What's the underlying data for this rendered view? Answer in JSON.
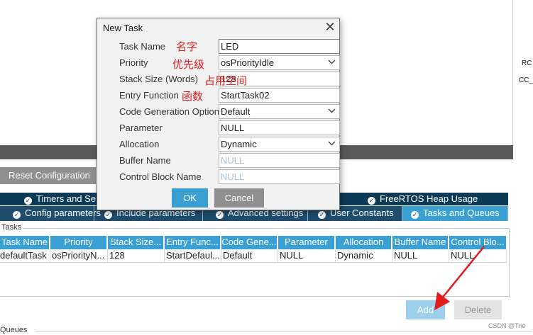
{
  "background": {
    "right_labels": [
      "RC",
      "CC_"
    ],
    "reset_button": "Reset Configuration",
    "tabs_row1": [
      {
        "label": "Timers and Se"
      },
      {
        "label": "FreeRTOS Heap Usage"
      }
    ],
    "tabs_row2": [
      {
        "label": "Config parameters"
      },
      {
        "label": "Include parameters"
      },
      {
        "label": "Advanced settings"
      },
      {
        "label": "User Constants"
      },
      {
        "label": "Tasks and Queues"
      }
    ],
    "tasks_group_label": "Tasks",
    "table": {
      "columns": [
        "Task Name",
        "Priority",
        "Stack Size...",
        "Entry Func...",
        "Code Gene...",
        "Parameter",
        "Allocation",
        "Buffer Name",
        "Control Blo..."
      ],
      "rows": [
        [
          "defaultTask",
          "osPriorityN...",
          "128",
          "StartDefaul...",
          "Default",
          "NULL",
          "Dynamic",
          "NULL",
          "NULL"
        ]
      ]
    },
    "add_button": "Add",
    "delete_button": "Delete",
    "queues_label": "Queues",
    "watermark": "CSDN @Trie"
  },
  "dialog": {
    "title": "New Task",
    "fields": [
      {
        "label": "Task Name",
        "value": "LED"
      },
      {
        "label": "Priority",
        "value": "osPriorityIdle"
      },
      {
        "label": "Stack Size (Words)",
        "value": "128"
      },
      {
        "label": "Entry Function",
        "value": "StartTask02"
      },
      {
        "label": "Code Generation Option",
        "value": "Default"
      },
      {
        "label": "Parameter",
        "value": "NULL"
      },
      {
        "label": "Allocation",
        "value": "Dynamic"
      },
      {
        "label": "Buffer Name",
        "value": "NULL"
      },
      {
        "label": "Control Block Name",
        "value": "NULL"
      }
    ],
    "ok_button": "OK",
    "cancel_button": "Cancel"
  },
  "annotations": {
    "task_name": "名字",
    "priority": "优先级",
    "stack_size": "占用空间",
    "entry_function": "函数"
  },
  "colors": {
    "accent": "#3aa0d4",
    "tab_dark": "#0b3a57",
    "annotation_red": "#e41b1b"
  }
}
